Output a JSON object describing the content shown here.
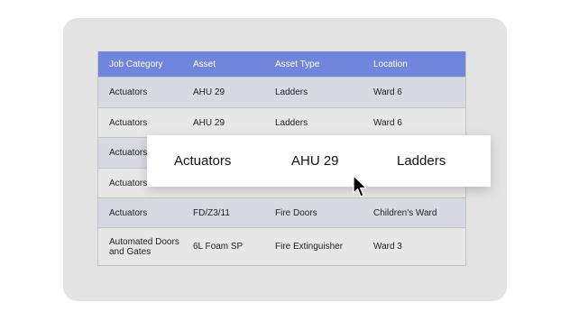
{
  "table": {
    "headers": [
      "Job Category",
      "Asset",
      "Asset Type",
      "Location"
    ],
    "rows": [
      [
        "Actuators",
        "AHU 29",
        "Ladders",
        "Ward 6"
      ],
      [
        "Actuators",
        "AHU 29",
        "Ladders",
        "Ward 6"
      ],
      [
        "Actuators",
        "",
        "",
        ""
      ],
      [
        "Actuators",
        "",
        "",
        ""
      ],
      [
        "Actuators",
        "FD/Z3/11",
        "Fire Doors",
        "Children's Ward"
      ],
      [
        "Automated Doors and Gates",
        "6L Foam SP",
        "Fire Extinguisher",
        "Ward 3"
      ]
    ]
  },
  "popup": {
    "job_category": "Actuators",
    "asset": "AHU 29",
    "asset_type": "Ladders"
  },
  "colors": {
    "header_bg": "#6f86dc",
    "row_shaded": "#d8dae3",
    "row_plain": "#e7e7e7",
    "card_bg": "#e3e3e3"
  },
  "icons": [
    "mouse-pointer-icon"
  ]
}
